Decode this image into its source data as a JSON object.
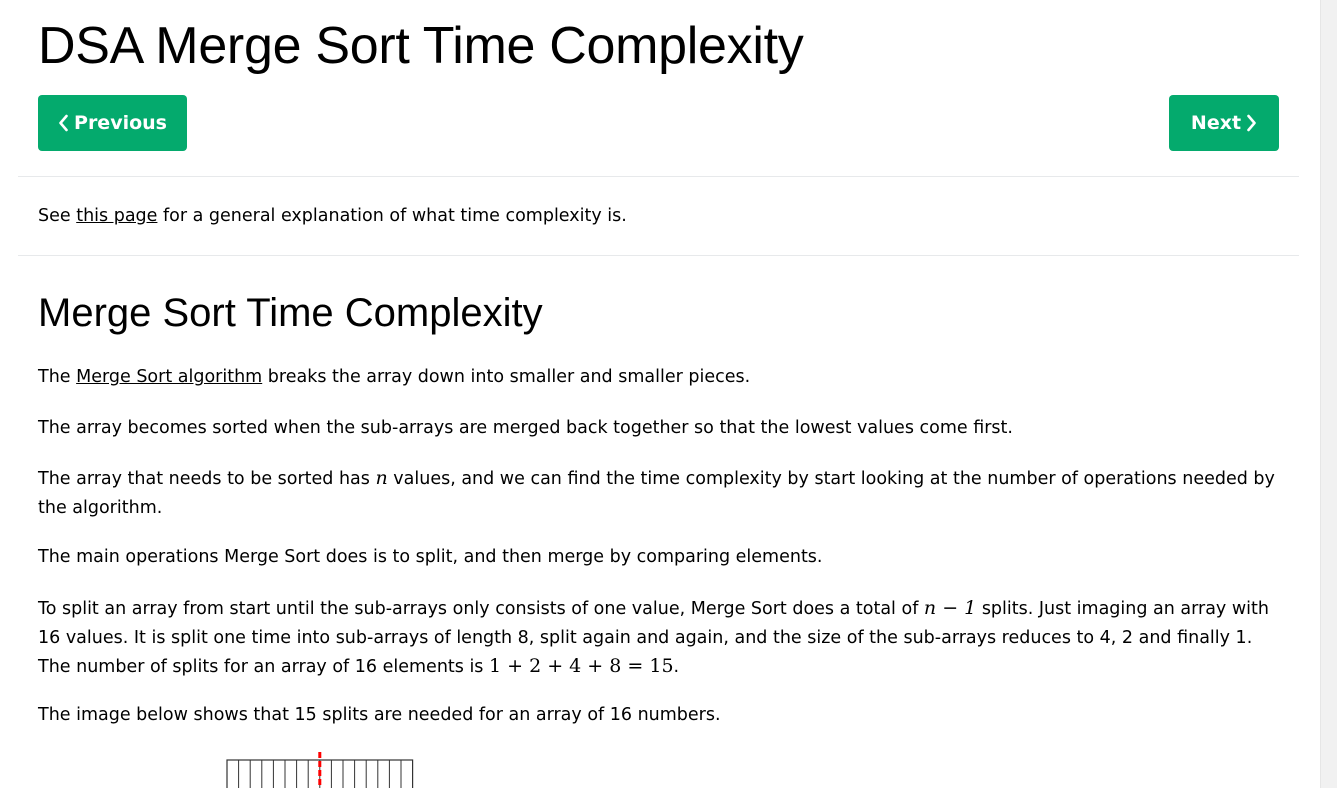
{
  "page": {
    "title": "DSA Merge Sort Time Complexity"
  },
  "nav": {
    "previous_label": "Previous",
    "next_label": "Next"
  },
  "intro": {
    "before_link": "See ",
    "link_text": "this page",
    "after_link": " for a general explanation of what time complexity is."
  },
  "section": {
    "title": "Merge Sort Time Complexity",
    "p1": {
      "before_link": "The ",
      "link_text": "Merge Sort algorithm",
      "after_link": " breaks the array down into smaller and smaller pieces."
    },
    "p2": "The array becomes sorted when the sub-arrays are merged back together so that the lowest values come first.",
    "p3": {
      "before_math": "The array that needs to be sorted has ",
      "math": "n",
      "after_math": " values, and we can find the time complexity by start looking at the number of operations needed by the algorithm."
    },
    "p4": "The main operations Merge Sort does is to split, and then merge by comparing elements.",
    "p5": {
      "before_math": "To split an array from start until the sub-arrays only consists of one value, Merge Sort does a total of ",
      "math_1": "n − 1",
      "middle": " splits. Just imaging an array with 16 values. It is split one time into sub-arrays of length 8, split again and again, and the size of the sub-arrays reduces to 4, 2 and finally 1. The number of splits for an array of 16 elements is ",
      "math_2": "1 + 2 + 4 + 8 = 15",
      "after_math": "."
    },
    "p6": "The image below shows that 15 splits are needed for an array of 16 numbers."
  },
  "diagram": {
    "cell_count": 16,
    "split_color": "#ff0000"
  },
  "colors": {
    "accent": "#04aa6d",
    "divider": "#e7e9eb"
  },
  "icons": {
    "previous": "chevron-left-icon",
    "next": "chevron-right-icon"
  }
}
